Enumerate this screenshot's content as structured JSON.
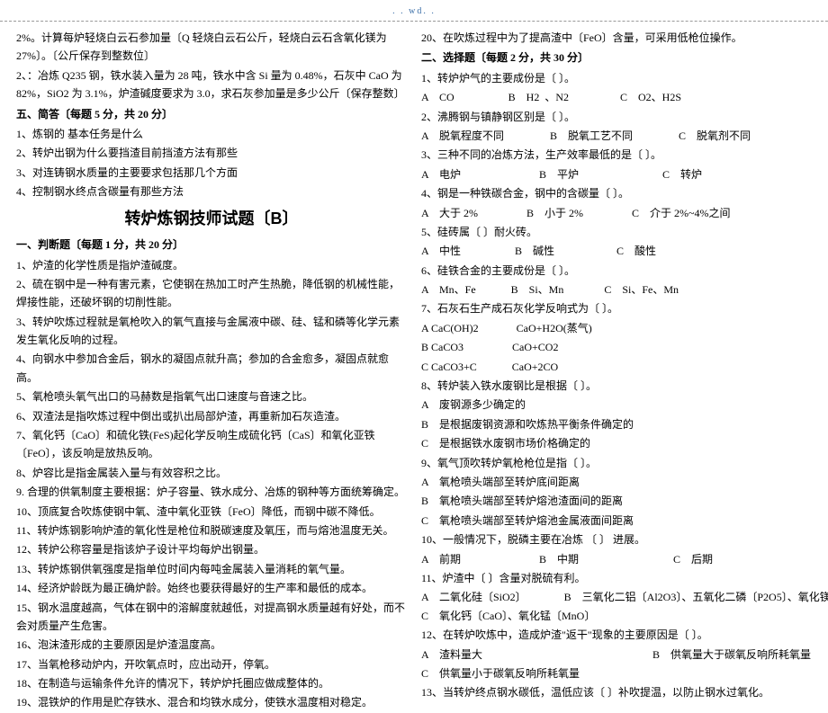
{
  "header": {
    "url": ". . wd. ."
  },
  "left": {
    "pre": [
      "2%。计算每炉轻烧白云石参加量〔Q 轻烧白云石公斤，轻烧白云石含氧化镁为 27%〕。〔公斤保存到整数位〕",
      "2、：冶炼 Q235 钢，铁水装入量为 28 吨，铁水中含 Si 量为 0.48%，石灰中 CaO 为 82%，SiO2 为 3.1%，炉渣碱度要求为 3.0，求石灰参加量是多少公斤〔保存整数〕"
    ],
    "section5": {
      "heading": "五、简答〔每题 5 分，共 20 分〕",
      "items": [
        "1、炼钢的      基本任务是什么",
        "2、转炉出钢为什么要挡渣目前挡渣方法有那些",
        "3、对连铸钢水质量的主要要求包括那几个方面",
        "4、控制钢水终点含碳量有那些方法"
      ]
    },
    "titleB": "转炉炼钢技师试题〔B〕",
    "section1": {
      "heading": "一、判断题〔每题 1 分，共     20 分〕",
      "items": [
        "1、炉渣的化学性质是指炉渣碱度。",
        "2、硫在钢中是一种有害元素，它使钢在热加工时产生热脆，降低钢的机械性能，焊接性能，还破坏钢的切削性能。",
        "3、转炉吹炼过程就是氧枪吹入的氧气直接与金属液中碳、硅、锰和磷等化学元素发生氧化反响的过程。",
        "4、向钢水中参加合金后，钢水的凝固点就升高；参加的合金愈多，凝固点就愈高。",
        "5、氧枪喷头氧气出口的马赫数是指氧气出口速度与音速之比。",
        "6、双渣法是指吹炼过程中倒出或扒出局部炉渣，再重新加石灰造渣。",
        "7、氧化钙〔CaO〕和硫化铁(FeS)起化学反响生成硫化钙〔CaS〕和氧化亚铁〔FeO〕，该反响是放热反响。",
        "8、炉容比是指金属装入量与有效容积之比。",
        "9.  合理的供氧制度主要根据：炉子容量、铁水成分、冶炼的钢种等方面统筹确定。",
        "10、顶底复合吹炼使钢中氧、渣中氧化亚铁〔FeO〕降低，而钢中碳不降低。",
        "11、转炉炼钢影响炉渣的氧化性是枪位和脱碳速度及氧压，而与熔池温度无关。",
        "12、转炉公称容量是指该炉子设计平均每炉出钢量。",
        "13、转炉炼钢供氧强度是指单位时间内每吨金属装入量消耗的氧气量。",
        "14、经济炉龄既为最正确炉龄。始终也要获得最好的生产率和最低的成本。",
        "15、钢水温度越高，气体在钢中的溶解度就越低，对提高钢水质量越有好处，而不会对质量产生危害。",
        "16、泡沫渣形成的主要原因是炉渣温度高。",
        "17、当氧枪移动炉内，开吹氧点时，应出动开，停氧。",
        "18、在制造与运输条件允许的情况下，转炉炉托圈应做成整体的。",
        "19、混铁炉的作用是贮存铁水、混合和均铁水成分，使铁水温度相对稳定。"
      ]
    }
  },
  "right": {
    "pre": [
      "20、在吹炼过程中为了提高渣中〔FeO〕含量，可采用低枪位操作。"
    ],
    "section2": {
      "heading": "二、选择题〔每题 2 分，共 30 分〕",
      "items": [
        {
          "q": "1、转炉炉气的主要成份是〔            〕。",
          "opts": "A    CO                    B    H2  、N2                   C    O2、H2S"
        },
        {
          "q": "2、沸腾钢与镇静钢区别是〔          〕。",
          "opts": "A    脱氧程度不同                 B    脱氧工艺不同                 C    脱氧剂不同"
        },
        {
          "q": "3、三种不同的冶炼方法，生产效率最低的是〔            〕。",
          "opts": "A    电炉                             B    平炉                               C    转炉"
        },
        {
          "q": "4、钢是一种铁碳合金，钢中的含碳量〔     〕。",
          "opts": "A    大于 2%                  B    小于 2%                  C    介于 2%~4%之间"
        },
        {
          "q": "5、硅砖属〔            〕耐火砖。",
          "opts": "A    中性                    B    碱性                       C    酸性"
        },
        {
          "q": "6、硅铁合金的主要成份是〔         〕。",
          "opts": "A    Mn、Fe             B    Si、Mn               C    Si、Fe、Mn"
        },
        {
          "q": "7、石灰石生产成石灰化学反响式为〔         〕。",
          "ml": [
            "A CaC(OH)2              CaO+H2O(蒸气)",
            "B CaCO3                  CaO+CO2",
            "C CaCO3+C             CaO+2CO"
          ]
        },
        {
          "q": "8、转炉装入铁水废钢比是根据〔         〕。",
          "ml": [
            "A    废钢源多少确定的",
            "B    是根据废钢资源和吹炼热平衡条件确定的",
            "C    是根据铁水废钢市场价格确定的"
          ]
        },
        {
          "q": "9、氧气顶吹转炉氧枪枪位是指〔     〕。",
          "ml": [
            "A    氧枪喷头端部至转炉底间距离",
            "B    氧枪喷头端部至转炉熔池渣面间的距离",
            "C    氧枪喷头端部至转炉熔池金属液面间距离"
          ]
        },
        {
          "q": "10、一般情况下，脱磷主要在冶炼       〔       〕       进展。",
          "opts": "A    前期                             B    中期                                   C    后期"
        },
        {
          "q": "11、炉渣中〔                  〕含量对脱硫有利。",
          "opts": "A    二氧化硅〔SiO2〕              B    三氧化二铝〔Al2O3〕、五氧化二磷〔P2O5〕、氧化镁〔MgO〕\nC    氧化钙〔CaO〕、氧化锰〔MnO〕"
        },
        {
          "q": "12、在转炉吹炼中，造成炉渣\"返干\"现象的主要原因是〔     〕。",
          "ml": [
            "A    渣料量大                                                               B    供氧量大于碳氧反响所耗氧量",
            "C    供氧量小于碳氧反响所耗氧量"
          ]
        },
        {
          "q": "13、当转炉终点钢水碳低，温低应该〔     〕补吹提温，以防止钢水过氧化。",
          "opts": ""
        }
      ]
    }
  }
}
